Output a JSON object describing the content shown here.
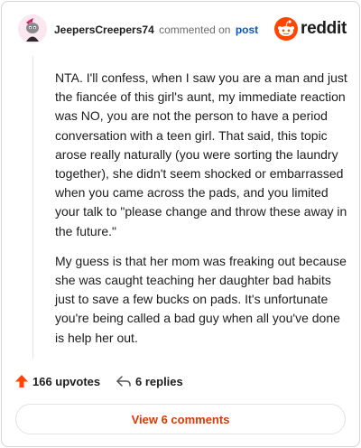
{
  "header": {
    "username": "JeepersCreepers74",
    "commented_text": "commented on",
    "post_link": "post",
    "brand_name": "reddit"
  },
  "comment": {
    "paragraphs": [
      "NTA. I'll confess, when I saw you are a man and just the fiancée of this girl's aunt, my immediate reaction was NO, you are not the person to have a period conversation with a teen girl. That said, this topic arose really naturally (you were sorting the laundry together), she didn't seem shocked or embarrassed when you came across the pads, and you limited your talk to \"please change and throw these away in the future.\"",
      "My guess is that her mom was freaking out because she was caught teaching her daughter bad habits just to save a few bucks on pads. It's unfortunate you're being called a bad guy when all you've done is help her out."
    ]
  },
  "actions": {
    "upvotes": "166 upvotes",
    "replies": "6 replies"
  },
  "view_comments_label": "View 6 comments",
  "colors": {
    "brand": "#ff4500",
    "link": "#0a56c8",
    "view_button_text": "#d93a00",
    "upvote_icon": "#ff4500"
  },
  "icons": {
    "avatar": "avatar",
    "brand": "reddit-logo-icon",
    "upvote": "upvote-arrow-icon",
    "reply": "reply-arrow-icon"
  }
}
